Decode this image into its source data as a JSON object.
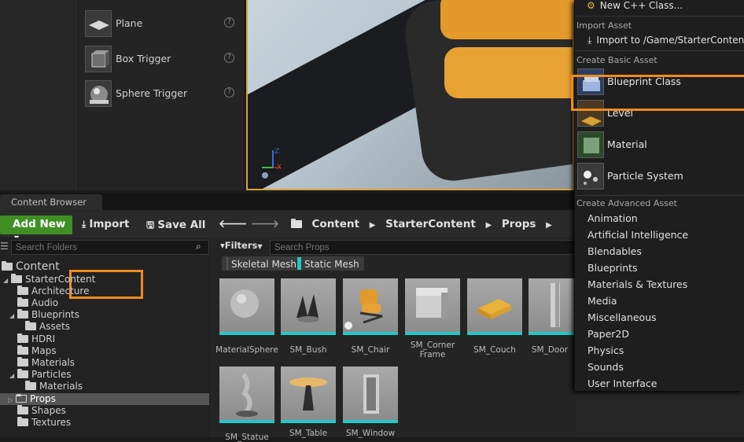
{
  "place_actors": {
    "items": [
      {
        "label": "Plane",
        "icon": "plane-icon"
      },
      {
        "label": "Box Trigger",
        "icon": "box-trigger-icon"
      },
      {
        "label": "Sphere Trigger",
        "icon": "sphere-trigger-icon"
      }
    ],
    "help_glyph": "?"
  },
  "viewport": {
    "axis_z": "Z",
    "axis_x": "X"
  },
  "content_browser": {
    "tab_label": "Content Browser",
    "toolbar": {
      "add_new_label": "Add New",
      "import_label": "Import",
      "save_all_label": "Save All"
    },
    "breadcrumb": [
      "Content",
      "StarterContent",
      "Props"
    ],
    "search_folders_placeholder": "Search Folders",
    "filters_label": "Filters",
    "search_props_placeholder": "Search Props",
    "filter_chips": [
      {
        "label": "Skeletal Mesh",
        "color": "#3a3a3a"
      },
      {
        "label": "Static Mesh",
        "color": "#27c6c6"
      }
    ],
    "tree": [
      {
        "label": "Content",
        "depth": 0
      },
      {
        "label": "StarterContent",
        "depth": 1
      },
      {
        "label": "Architecture",
        "depth": 2
      },
      {
        "label": "Audio",
        "depth": 2
      },
      {
        "label": "Blueprints",
        "depth": 2
      },
      {
        "label": "Assets",
        "depth": 3
      },
      {
        "label": "HDRI",
        "depth": 2
      },
      {
        "label": "Maps",
        "depth": 2
      },
      {
        "label": "Materials",
        "depth": 2
      },
      {
        "label": "Particles",
        "depth": 2
      },
      {
        "label": "Materials",
        "depth": 3
      },
      {
        "label": "Props",
        "depth": 2
      },
      {
        "label": "Shapes",
        "depth": 2
      },
      {
        "label": "Textures",
        "depth": 2
      }
    ],
    "assets": [
      {
        "label": "MaterialSphere"
      },
      {
        "label": "SM_Bush"
      },
      {
        "label": "SM_Chair"
      },
      {
        "label": "SM_Corner Frame"
      },
      {
        "label": "SM_Couch"
      },
      {
        "label": "SM_Door"
      },
      {
        "label": "SM_Statue"
      },
      {
        "label": "SM_Table"
      },
      {
        "label": "SM_Window"
      }
    ]
  },
  "context_menu": {
    "top_item": "New C++ Class...",
    "import_header": "Import Asset",
    "import_item": "Import to /Game/StarterContent/Pr",
    "basic_header": "Create Basic Asset",
    "basic_items": [
      {
        "label": "Blueprint Class",
        "icon": "blueprint-class-icon"
      },
      {
        "label": "Level",
        "icon": "level-icon"
      },
      {
        "label": "Material",
        "icon": "material-icon"
      },
      {
        "label": "Particle System",
        "icon": "particle-system-icon"
      }
    ],
    "advanced_header": "Create Advanced Asset",
    "advanced_items": [
      "Animation",
      "Artificial Intelligence",
      "Blendables",
      "Blueprints",
      "Materials & Textures",
      "Media",
      "Miscellaneous",
      "Paper2D",
      "Physics",
      "Sounds",
      "User Interface"
    ]
  },
  "colors": {
    "accent_highlight": "#ef8b1e",
    "add_new_green": "#3f8f25",
    "static_mesh_cyan": "#27c6c6"
  }
}
